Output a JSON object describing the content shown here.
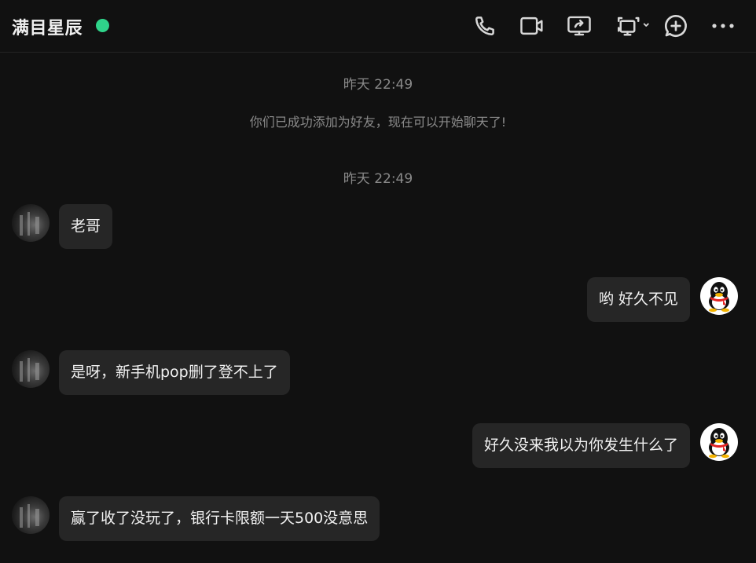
{
  "header": {
    "contact_name": "满目星辰",
    "online_status_color": "#2fd48a",
    "actions": [
      "phone-icon",
      "video-icon",
      "screen-share-icon",
      "remote-assist-icon",
      "add-icon",
      "more-icon"
    ]
  },
  "chat": {
    "timestamp_1": "昨天 22:49",
    "system_message": "你们已成功添加为好友，现在可以开始聊天了!",
    "timestamp_2": "昨天 22:49",
    "messages": [
      {
        "sender": "friend",
        "text": "老哥"
      },
      {
        "sender": "self",
        "text": "哟 好久不见"
      },
      {
        "sender": "friend",
        "text": "是呀，新手机pop删了登不上了"
      },
      {
        "sender": "self",
        "text": "好久没来我以为你发生什么了"
      },
      {
        "sender": "friend",
        "text": "赢了收了没玩了，银行卡限额一天500没意思"
      }
    ]
  },
  "colors": {
    "background": "#111111",
    "bubble": "#262626",
    "muted_text": "#8a8a8a"
  }
}
